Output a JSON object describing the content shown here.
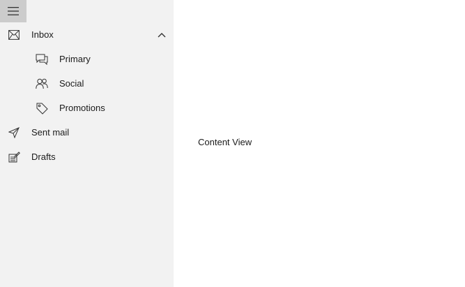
{
  "hamburger": {
    "icon": "hamburger-menu-icon"
  },
  "nav": {
    "inbox": {
      "label": "Inbox",
      "icon": "mail-icon",
      "expanded": true
    },
    "primary": {
      "label": "Primary",
      "icon": "chat-bubbles-icon"
    },
    "social": {
      "label": "Social",
      "icon": "people-icon"
    },
    "promotions": {
      "label": "Promotions",
      "icon": "tag-icon"
    },
    "sent": {
      "label": "Sent mail",
      "icon": "send-icon"
    },
    "drafts": {
      "label": "Drafts",
      "icon": "edit-document-icon"
    }
  },
  "content": {
    "text": "Content View"
  },
  "colors": {
    "pane_background": "#f2f2f2",
    "hamburger_background": "#cccccc",
    "content_background": "#ffffff",
    "text": "#1a1a1a"
  }
}
